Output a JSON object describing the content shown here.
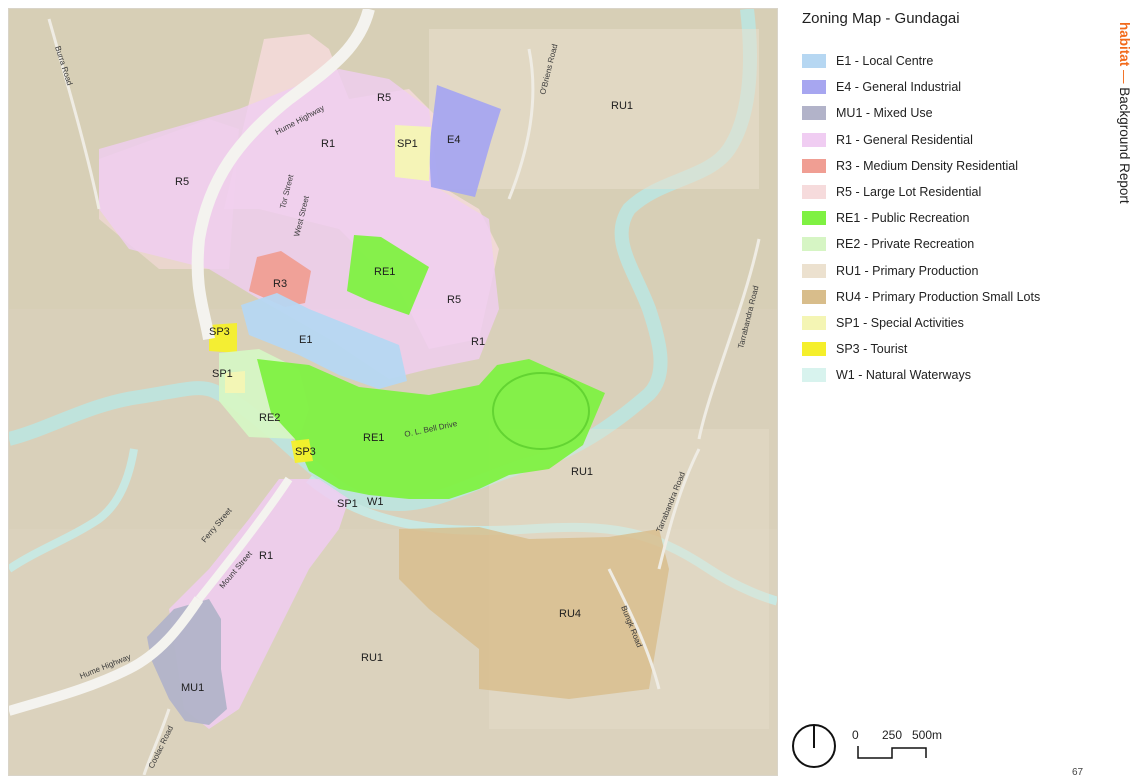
{
  "title": "Zoning Map - Gundagai",
  "side_title": {
    "brand": "habitat",
    "dash": " — ",
    "text": "Background Report"
  },
  "page_number": "67",
  "legend": [
    {
      "label": "E1 - Local Centre",
      "color": "#b6d7f2"
    },
    {
      "label": "E4 - General Industrial",
      "color": "#a7a6f0"
    },
    {
      "label": "MU1 - Mixed Use",
      "color": "#b2b3c9"
    },
    {
      "label": "R1 - General Residential",
      "color": "#f0cdf2"
    },
    {
      "label": "R3 - Medium Density Residential",
      "color": "#f09e93"
    },
    {
      "label": "R5 - Large Lot Residential",
      "color": "#f6dbdc"
    },
    {
      "label": "RE1 - Public Recreation",
      "color": "#7ff142"
    },
    {
      "label": "RE2 - Private Recreation",
      "color": "#d6f5c4"
    },
    {
      "label": "RU1 - Primary Production",
      "color": "#ece1cf"
    },
    {
      "label": "RU4 - Primary Production Small Lots",
      "color": "#d8bd8b"
    },
    {
      "label": "SP1 - Special Activities",
      "color": "#f4f5b4"
    },
    {
      "label": "SP3 - Tourist",
      "color": "#f5ef2b"
    },
    {
      "label": "W1 - Natural Waterways",
      "color": "#d8f3ee"
    }
  ],
  "zone_labels": {
    "r5_west": "R5",
    "r5_north": "R5",
    "r1_north": "R1",
    "sp1_north": "SP1",
    "e4": "E4",
    "ru1_ne": "RU1",
    "r3": "R3",
    "re1_north": "RE1",
    "r5_east": "R5",
    "sp3_west": "SP3",
    "e1": "E1",
    "r1_east": "R1",
    "sp1_west": "SP1",
    "re2": "RE2",
    "re1_centre": "RE1",
    "sp3_centre": "SP3",
    "sp1_south": "SP1",
    "w1": "W1",
    "ru1_east": "RU1",
    "r1_south": "R1",
    "ru4": "RU4",
    "ru1_south": "RU1",
    "mu1": "MU1"
  },
  "road_labels": {
    "burra": "Burra Road",
    "hume_north": "Hume Highway",
    "obriens": "O'Briens Road",
    "tor": "Tor Street",
    "west": "West Street",
    "tarrabandra_north": "Tarrabandra Road",
    "ol_bell": "O. L. Bell Drive",
    "ferry": "Ferry Street",
    "mount": "Mount Street",
    "tarrabandra_south": "Tarrabandra Road",
    "bungk": "Bungk Road",
    "hume_south": "Hume Highway",
    "coolac": "Coolac Road"
  },
  "scale": {
    "zero": "0",
    "mid": "250",
    "end": "500",
    "unit": "m"
  }
}
